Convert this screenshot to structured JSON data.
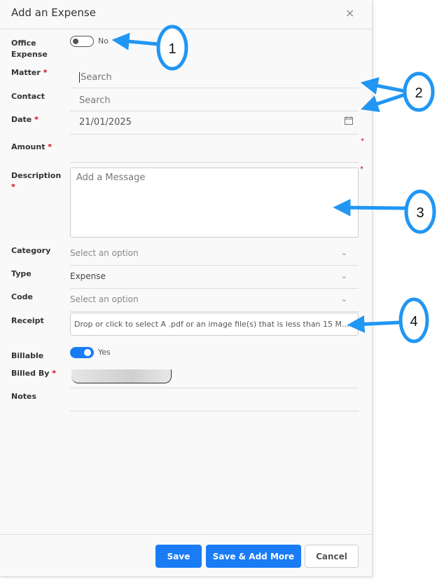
{
  "header": {
    "title": "Add an Expense",
    "close": "×"
  },
  "fields": {
    "office_expense": {
      "label": "Office Expense",
      "value": "No",
      "on": false
    },
    "matter": {
      "label": "Matter",
      "required": "*",
      "placeholder": "Search"
    },
    "contact": {
      "label": "Contact",
      "placeholder": "Search"
    },
    "date": {
      "label": "Date",
      "required": "*",
      "value": "21/01/2025"
    },
    "amount": {
      "label": "Amount",
      "required": "*"
    },
    "description": {
      "label": "Description",
      "required": "*",
      "placeholder": "Add a Message"
    },
    "category": {
      "label": "Category",
      "value": "Select an option"
    },
    "type": {
      "label": "Type",
      "value": "Expense"
    },
    "code": {
      "label": "Code",
      "value": "Select an option"
    },
    "receipt": {
      "label": "Receipt",
      "placeholder": "Drop or click to select A .pdf or an image file(s) that is less than 15 M..."
    },
    "billable": {
      "label": "Billable",
      "value": "Yes",
      "on": true
    },
    "billed_by": {
      "label": "Billed By",
      "required": "*"
    },
    "notes": {
      "label": "Notes"
    }
  },
  "footer": {
    "save": "Save",
    "save_add": "Save & Add More",
    "cancel": "Cancel"
  },
  "annotations": [
    "1",
    "2",
    "3",
    "4"
  ],
  "colors": {
    "accent": "#1a7cf5",
    "annotation": "#2196f3",
    "required": "#d0021b"
  }
}
